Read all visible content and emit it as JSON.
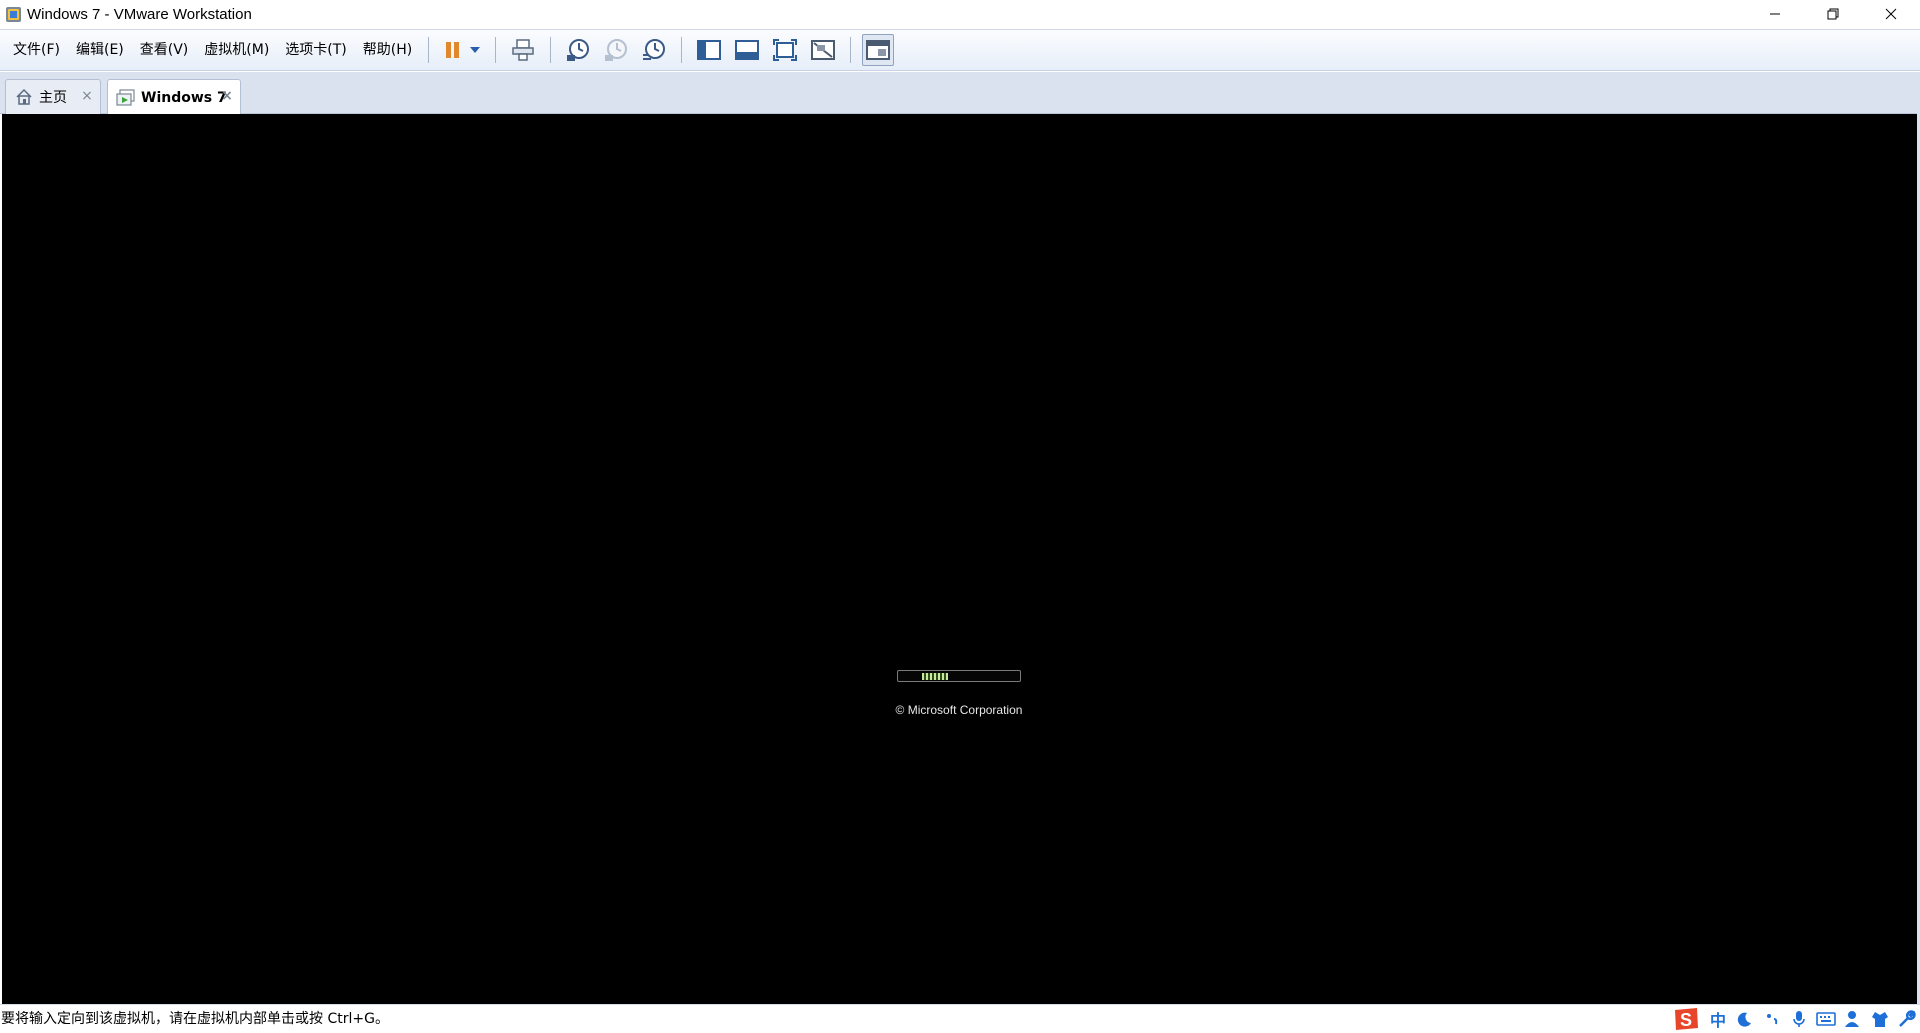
{
  "window": {
    "title": "Windows 7 - VMware Workstation"
  },
  "menu": {
    "items": [
      "文件(F)",
      "编辑(E)",
      "查看(V)",
      "虚拟机(M)",
      "选项卡(T)",
      "帮助(H)"
    ]
  },
  "toolbar": {
    "icons": [
      "pause-icon",
      "dropdown-arrow-icon",
      "send-ctrl-alt-del-icon",
      "snapshot-take-icon",
      "snapshot-revert-icon",
      "snapshot-manager-icon",
      "show-library-icon",
      "show-thumbnail-bar-icon",
      "fullscreen-icon",
      "unity-icon",
      "console-view-icon"
    ]
  },
  "tabs": [
    {
      "label": "主页",
      "icon": "home-icon"
    },
    {
      "label": "Windows 7",
      "icon": "vm-icon"
    }
  ],
  "vm_screen": {
    "copyright": "© Microsoft Corporation"
  },
  "status": {
    "message": "要将输入定向到该虚拟机，请在虚拟机内部单击或按 Ctrl+G。"
  },
  "ime_tray": {
    "chinese_mode": "中"
  },
  "colors": {
    "vm_background": "#000000",
    "toolbar_gradient_end": "#e6eef9",
    "ime_blue": "#1e6fd8",
    "ime_logo_red": "#e8462b"
  }
}
